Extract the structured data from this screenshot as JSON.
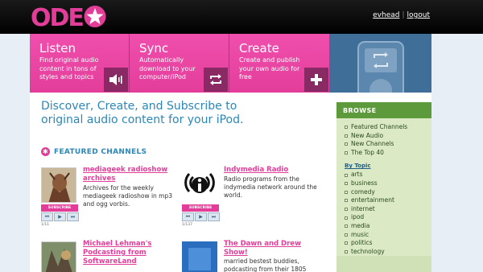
{
  "header": {
    "logo_text": "ODEO",
    "user": "evhead",
    "separator": "|",
    "logout": "logout"
  },
  "promo": {
    "tiles": [
      {
        "title": "Listen",
        "desc": "Find original audio content in tons of styles and topics",
        "icon": "speaker-icon"
      },
      {
        "title": "Sync",
        "desc": "Automatically download to your computer/iPod",
        "icon": "sync-icon"
      },
      {
        "title": "Create",
        "desc": "Create and publish your own audio for free",
        "icon": "plus-icon"
      }
    ]
  },
  "main": {
    "headline": "Discover, Create, and Subscribe to original audio content for your iPod.",
    "featured_heading": "FEATURED CHANNELS",
    "channels": [
      {
        "title": "mediageek radioshow archives",
        "desc": "Archives for the weekly mediageek radioshow in mp3 and ogg vorbis.",
        "count": "1/11",
        "subscribe": "SUBSCRIBE"
      },
      {
        "title": "Indymedia Radio",
        "desc": "Radio programs from the indymedia network around the world.",
        "count": "1/137",
        "subscribe": "SUBSCRIBE"
      },
      {
        "title": "Michael Lehman's Podcasting from SoftwareLand",
        "desc": "",
        "count": "",
        "subscribe": ""
      },
      {
        "title": "The Dawn and Drew Show!",
        "desc": "married bestest buddies, podcasting from their 1805",
        "count": "",
        "subscribe": ""
      }
    ],
    "controls": [
      "⏮",
      "▶",
      "⏭"
    ]
  },
  "sidebar": {
    "heading": "BROWSE",
    "browse_items": [
      "Featured Channels",
      "New Audio",
      "New Channels",
      "The Top 40"
    ],
    "topic_heading": "By Topic",
    "topics": [
      "arts",
      "business",
      "comedy",
      "entertainment",
      "internet",
      "ipod",
      "media",
      "music",
      "politics",
      "technology"
    ]
  },
  "colors": {
    "brand_pink": "#e33d9a",
    "link_blue": "#2c87b8",
    "sidebar_green": "#5d9a3c",
    "ipod_blue": "#3f6e99"
  }
}
